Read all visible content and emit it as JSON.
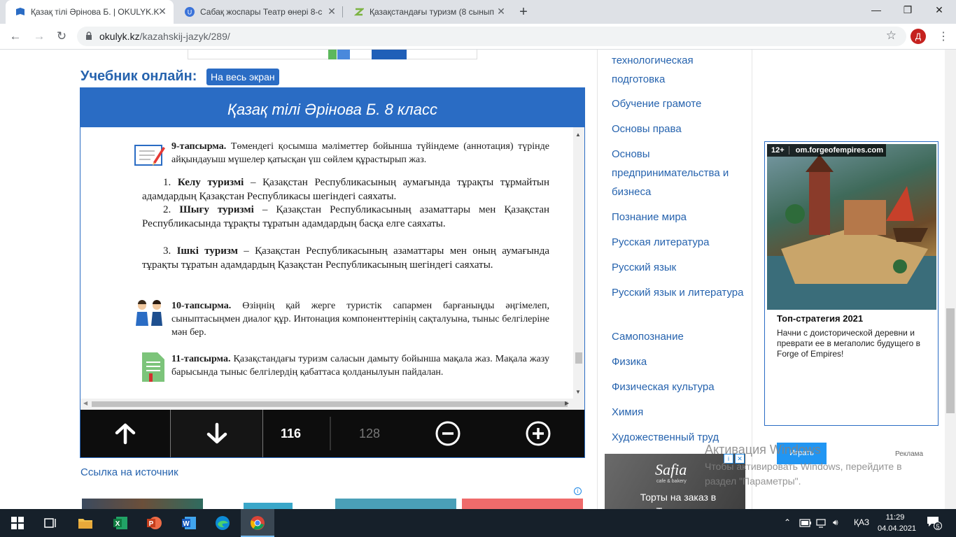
{
  "browser": {
    "tabs": [
      {
        "title": "Қазақ тілі Әрінова Б. | OKULYK.K",
        "active": true
      },
      {
        "title": "Сабақ жоспары Театр өнері 8-с",
        "active": false
      },
      {
        "title": "Қазақстандағы туризм (8 сынып",
        "active": false
      }
    ],
    "url_domain": "okulyk.kz",
    "url_path": "/kazahskij-jazyk/289/",
    "profile_initial": "Д"
  },
  "page": {
    "headline": "Учебник онлайн:",
    "fullscreen_label": "На весь экран",
    "viewer_title": "Қазақ тілі Әрінова Б. 8 класс",
    "source_link": "Ссылка на источник"
  },
  "book": {
    "task9_label": "9-тапсырма.",
    "task9_text": " Төмендегі қосымша мәліметтер бойынша түйіндеме (аннотация) түрінде айқындауыш мүшелер қатысқан үш сөйлем құрастырып жаз.",
    "items": [
      {
        "num": "1.",
        "term": "Келу туризмі",
        "text": " – Қазақстан Республикасының аумағында тұрақты тұрмайтын адамдардың Қазақстан Республикасы шегіндегі саяхаты."
      },
      {
        "num": "2.",
        "term": "Шығу туризмі",
        "text": " – Қазақстан Республикасының азаматтары мен Қазақстан Республикасында тұрақты тұратын адамдардың басқа елге саяхаты."
      },
      {
        "num": "3.",
        "term": "Ішкі туризм",
        "text": " – Қазақстан Республикасының азаматтары мен оның аумағында тұрақты тұратын адамдардың Қазақстан Республикасының шегіндегі саяхаты."
      }
    ],
    "task10_label": "10-тапсырма.",
    "task10_text": " Өзіңнің қай жерге туристік сапармен барғаныңды әңгімелеп, сыныптасыңмен диалог құр. Интонация компоненттерінің сақталуына, тыныс белгілеріне мән бер.",
    "task11_label": "11-тапсырма.",
    "task11_text": " Қазақстандағы туризм саласын дамыту бойынша мақала жаз. Мақала жазу барысында тыныс белгілердің қабаттаса қолданылуын пайдалан."
  },
  "controls": {
    "current_page": "116",
    "total_pages": "128"
  },
  "sidebar": {
    "items": [
      "технологическая подготовка",
      "Обучение грамоте",
      "Основы права",
      "Основы предпринимательства и бизнеса",
      "Познание мира",
      "Русская литература",
      "Русский язык",
      "Русский язык и литература",
      "Самопознание",
      "Физика",
      "Физическая культура",
      "Химия",
      "Художественный труд"
    ]
  },
  "ad": {
    "age": "12+",
    "domain": "om.forgeofempires.com",
    "title": "Топ-стратегия 2021",
    "text": "Начни с доисторической деревни и преврати ее в мегаполис будущего в Forge of Empires!",
    "button": "Играть",
    "label": "Реклама"
  },
  "safia_ad": {
    "brand": "Safia",
    "sub": "cafe & bakery",
    "text": "Торты на заказ в Ташкенте"
  },
  "activation": {
    "title": "Активация Windows",
    "text": "Чтобы активировать Windows, перейдите в раздел \"Параметры\"."
  },
  "taskbar": {
    "lang": "ҚАЗ",
    "time": "11:29",
    "date": "04.04.2021",
    "notifications": "5"
  },
  "colors": {
    "brand_blue": "#2a6cc4",
    "link_blue": "#2663ae",
    "taskbar": "#16202a"
  }
}
